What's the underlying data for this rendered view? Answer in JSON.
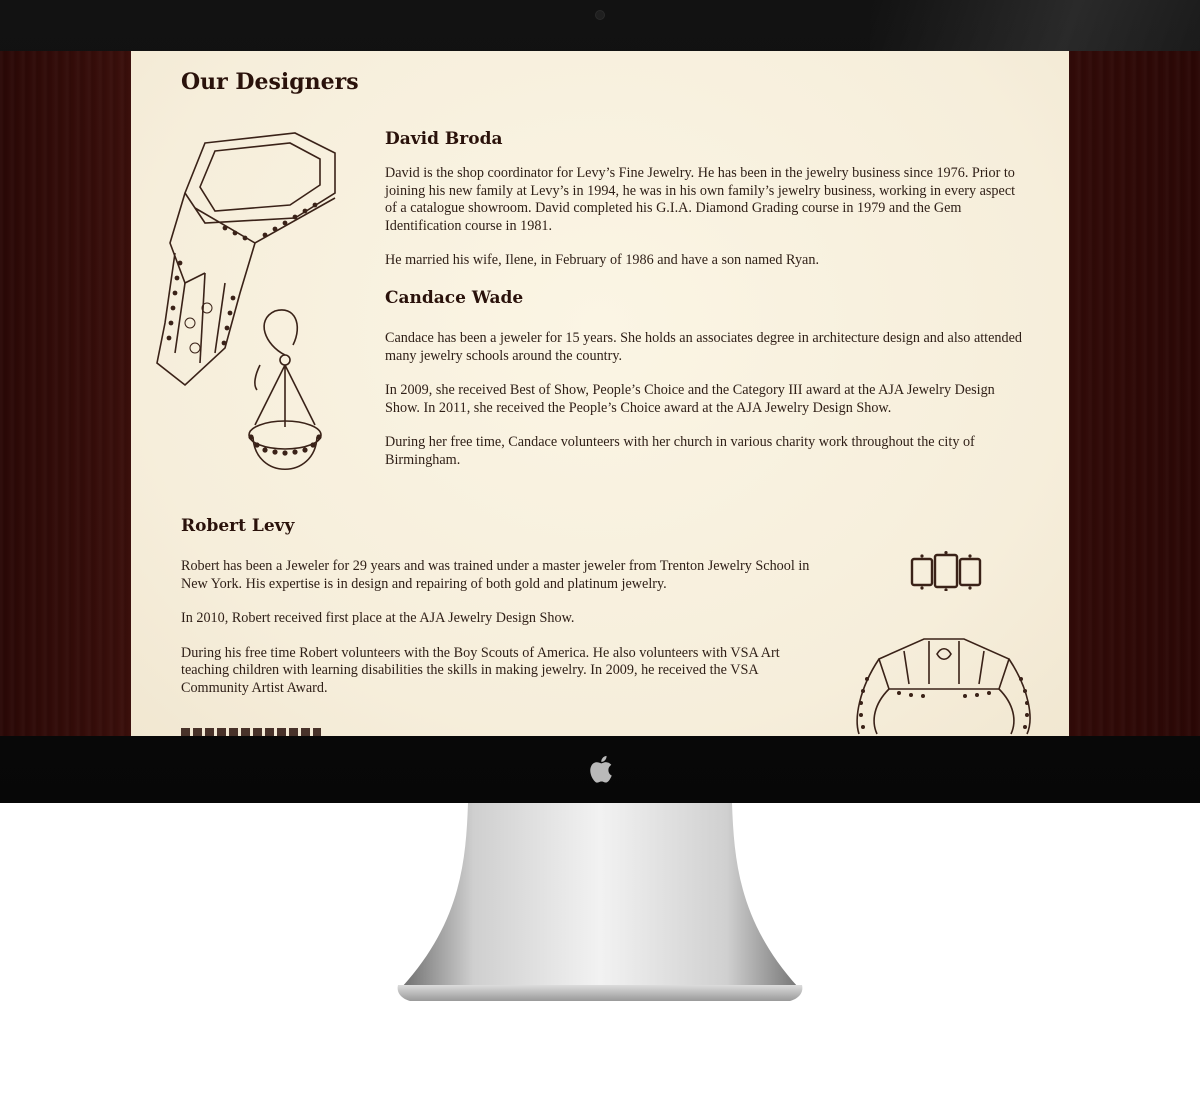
{
  "page": {
    "title": "Our Designers"
  },
  "designers": [
    {
      "name": "David Broda",
      "paragraphs": [
        "David is the shop coordinator for Levy’s Fine Jewelry. He has been in the jewelry business since 1976. Prior to joining his new family at Levy’s in 1994, he was in his own family’s jewelry business, working in every aspect of a catalogue showroom. David completed his G.I.A. Diamond Grading course in 1979 and the Gem Identification course in 1981.",
        "He married his wife, Ilene, in February of 1986 and have a son named Ryan."
      ]
    },
    {
      "name": "Candace Wade",
      "paragraphs": [
        "Candace has been a jeweler for 15 years. She holds an associates degree in architecture design and also attended many jewelry schools around the country.",
        "In 2009, she received Best of Show, People’s Choice and the Category III award at the AJA Jewelry Design Show. In 2011, she received the People’s Choice award at the AJA Jewelry Design Show.",
        "During her free time, Candace volunteers with her church in various charity work throughout the city of Birmingham."
      ]
    },
    {
      "name": "Robert Levy",
      "paragraphs": [
        "Robert has been a Jeweler for 29 years and was trained under a master jeweler from Trenton Jewelry School in New York. His expertise is in design and repairing of both gold and platinum jewelry.",
        "In 2010, Robert received first place at the AJA Jewelry Design Show.",
        "During his free time Robert volunteers with the Boy Scouts of America. He also volunteers with VSA Art teaching children with learning disabilities the skills in making jewelry. In 2009, he received the VSA Community Artist Award."
      ]
    }
  ],
  "colors": {
    "page_background": "#f6eedb",
    "heading": "#2a120b",
    "body_text": "#2e1e16",
    "wood": "#3b0f0b",
    "bezel": "#0b0b0b"
  },
  "icons": {
    "monitor_logo": "apple-logo-icon",
    "sketches": [
      "ring-sketch-icon",
      "earring-sketch-icon",
      "band-sketch-icon",
      "engagement-ring-sketch-icon"
    ]
  }
}
